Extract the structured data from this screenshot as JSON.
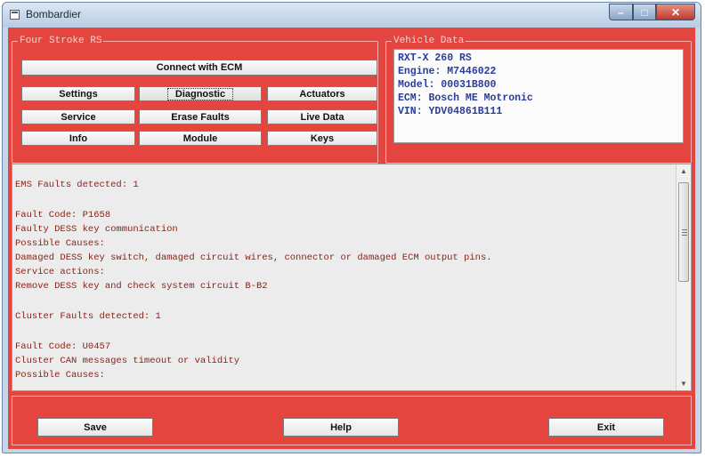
{
  "window": {
    "title": "Bombardier"
  },
  "window_controls": {
    "minimize": "–",
    "maximize": "□",
    "close": "✕"
  },
  "groups": {
    "main": "Four Stroke RS",
    "vehicle": "Vehicle Data"
  },
  "buttons": {
    "connect": "Connect with ECM",
    "settings": "Settings",
    "diagnostic": "Diagnostic",
    "actuators": "Actuators",
    "service": "Service",
    "erase_faults": "Erase Faults",
    "live_data": "Live Data",
    "info": "Info",
    "module": "Module",
    "keys": "Keys",
    "save": "Save",
    "help": "Help",
    "exit": "Exit"
  },
  "vehicle": {
    "lines": [
      "RXT-X 260 RS",
      "Engine: M7446022",
      "Model: 00031B800",
      "ECM: Bosch ME Motronic",
      "VIN: YDV04861B111"
    ]
  },
  "output": {
    "lines": [
      "EMS Faults detected: 1",
      "",
      "Fault Code: P1658",
      "Faulty DESS key communication",
      "Possible Causes:",
      "Damaged DESS key switch, damaged circuit wires, connector or damaged ECM output pins.",
      "Service actions:",
      "Remove DESS key and check system circuit B-B2",
      "",
      "Cluster Faults detected: 1",
      "",
      "Fault Code: U0457",
      "Cluster CAN messages timeout or validity",
      "Possible Causes:"
    ]
  },
  "scrollbar": {
    "up": "▲",
    "down": "▼"
  }
}
